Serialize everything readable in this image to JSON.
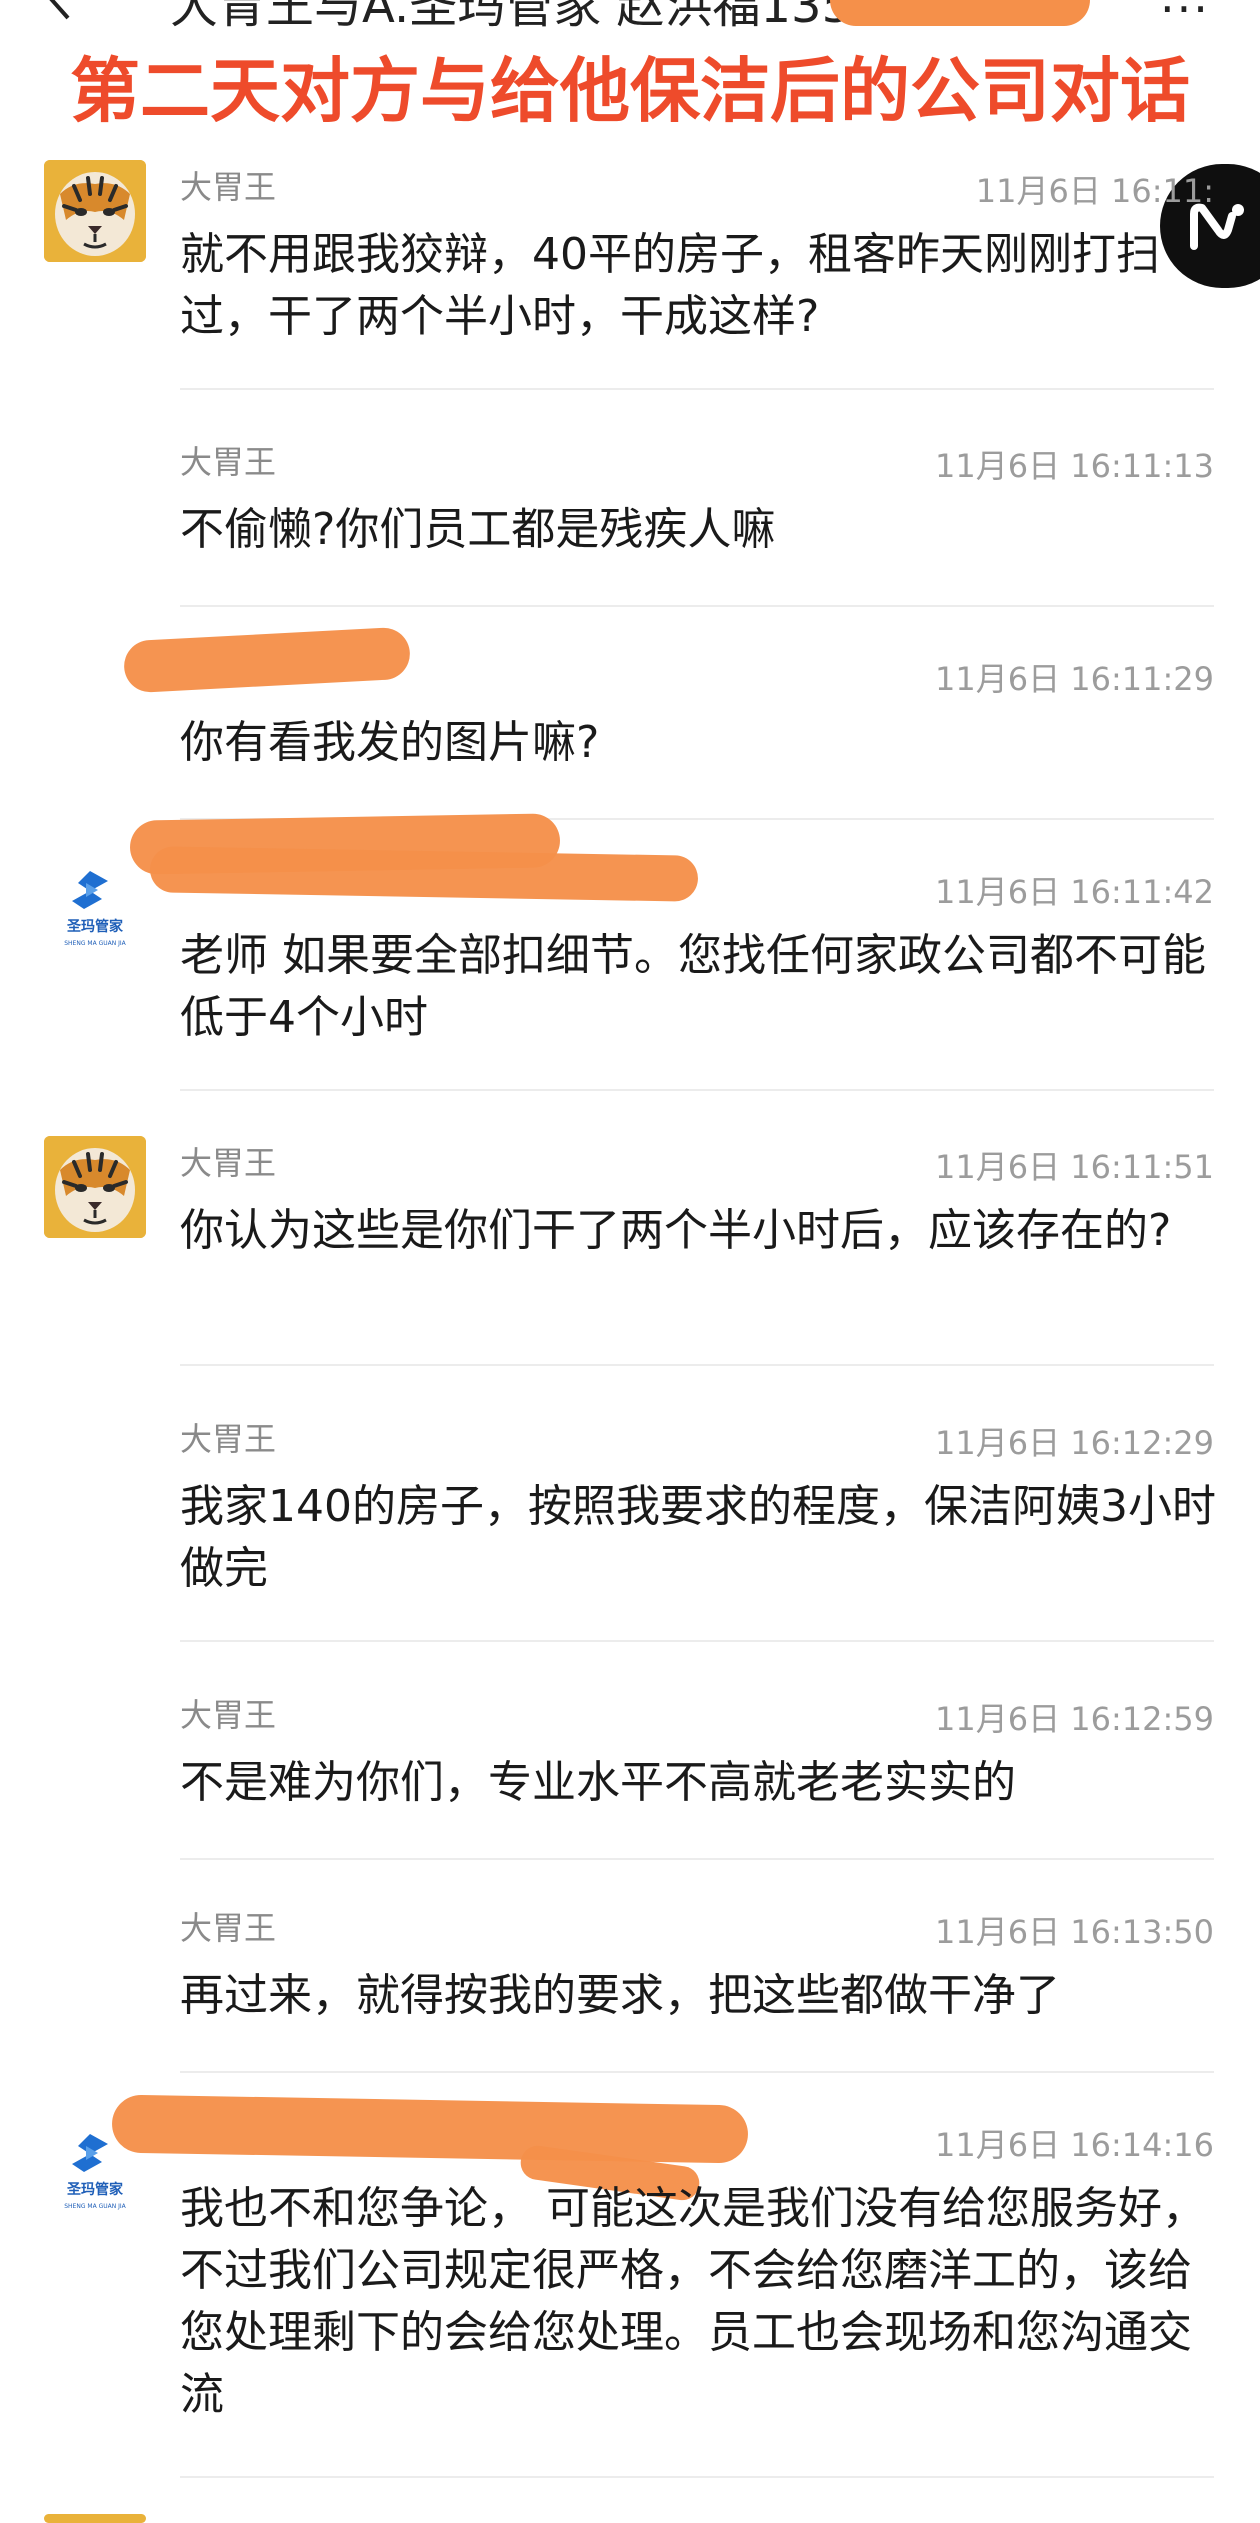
{
  "header": {
    "title": "大胃王与A.圣玛管家 赵洪福135",
    "caption": "第二天对方与给他保洁后的公司对话"
  },
  "messages": [
    {
      "sender": "大胃王",
      "time": "11月6日 16:11:",
      "text": "就不用跟我狡辩，40平的房子，租客昨天刚刚打扫过，干了两个半小时，干成这样?",
      "avatar": "tiger-avatar"
    },
    {
      "sender": "大胃王",
      "time": "11月6日 16:11:13",
      "text": "不偷懒?你们员工都是残疾人嘛",
      "avatar": ""
    },
    {
      "sender": "",
      "time": "11月6日 16:11:29",
      "text": "你有看我发的图片嘛?",
      "avatar": ""
    },
    {
      "sender": "",
      "time": "11月6日 16:11:42",
      "text": "老师  如果要全部扣细节。您找任何家政公司都不可能低于4个小时",
      "avatar": "shengma-logo"
    },
    {
      "sender": "大胃王",
      "time": "11月6日 16:11:51",
      "text": "你认为这些是你们干了两个半小时后，应该存在的?",
      "avatar": "tiger-avatar"
    },
    {
      "sender": "大胃王",
      "time": "11月6日 16:12:29",
      "text": "我家140的房子，按照我要求的程度，保洁阿姨3小时做完",
      "avatar": ""
    },
    {
      "sender": "大胃王",
      "time": "11月6日 16:12:59",
      "text": "不是难为你们，专业水平不高就老老实实的",
      "avatar": ""
    },
    {
      "sender": "大胃王",
      "time": "11月6日 16:13:50",
      "text": "再过来，就得按我的要求，把这些都做干净了",
      "avatar": ""
    },
    {
      "sender": "",
      "time": "11月6日 16:14:16",
      "text": "我也不和您争论， 可能这次是我们没有给您服务好，不过我们公司规定很严格，不会给您磨洋工的，该给您处理剩下的会给您处理。员工也会现场和您沟通交流",
      "avatar": "shengma-logo"
    }
  ],
  "logo": {
    "cn": "圣玛管家",
    "en": "SHENG MA GUAN JIA"
  },
  "colors": {
    "caption": "#ee4b2b",
    "redaction": "#f5904a",
    "time": "#9c9c9c",
    "sender": "#8a8a8a"
  }
}
